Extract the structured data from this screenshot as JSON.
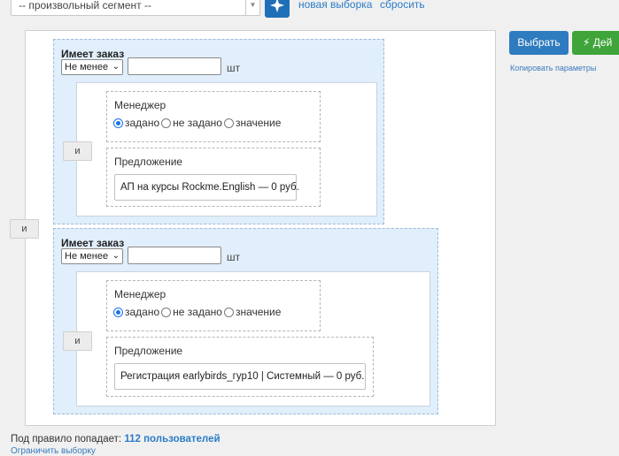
{
  "topbar": {
    "segment_select_value": "-- произвольный сегмент --",
    "new_selection_link": "новая выборка",
    "reset_link": "сбросить"
  },
  "actions": {
    "select_button": "Выбрать",
    "action_button": "Дей",
    "copy_params_link": "Копировать параметры"
  },
  "rule": {
    "root_and_label": "и",
    "groups": [
      {
        "title": "Имеет заказ",
        "operator": "Не менее",
        "quantity": "",
        "unit": "шт",
        "and_label": "и",
        "manager": {
          "title": "Менеджер",
          "options": [
            "задано",
            "не задано",
            "значение"
          ],
          "selected": "задано"
        },
        "offer": {
          "title": "Предложение",
          "value": "АП на курсы Rockme.English — 0 руб."
        }
      },
      {
        "title": "Имеет заказ",
        "operator": "Не менее",
        "quantity": "",
        "unit": "шт",
        "and_label": "и",
        "manager": {
          "title": "Менеджер",
          "options": [
            "задано",
            "не задано",
            "значение"
          ],
          "selected": "задано"
        },
        "offer": {
          "title": "Предложение",
          "value": "Регистрация earlybirds_гур10 | Системный — 0 руб."
        }
      }
    ]
  },
  "footer": {
    "prefix": "Под правило попадает:",
    "count": "112 пользователей",
    "limit_link": "Ограничить выборку"
  },
  "colors": {
    "primary": "#2f7bbf",
    "success": "#3fa53a",
    "group_bg": "#e1eefb",
    "link": "#2a7cc7"
  }
}
